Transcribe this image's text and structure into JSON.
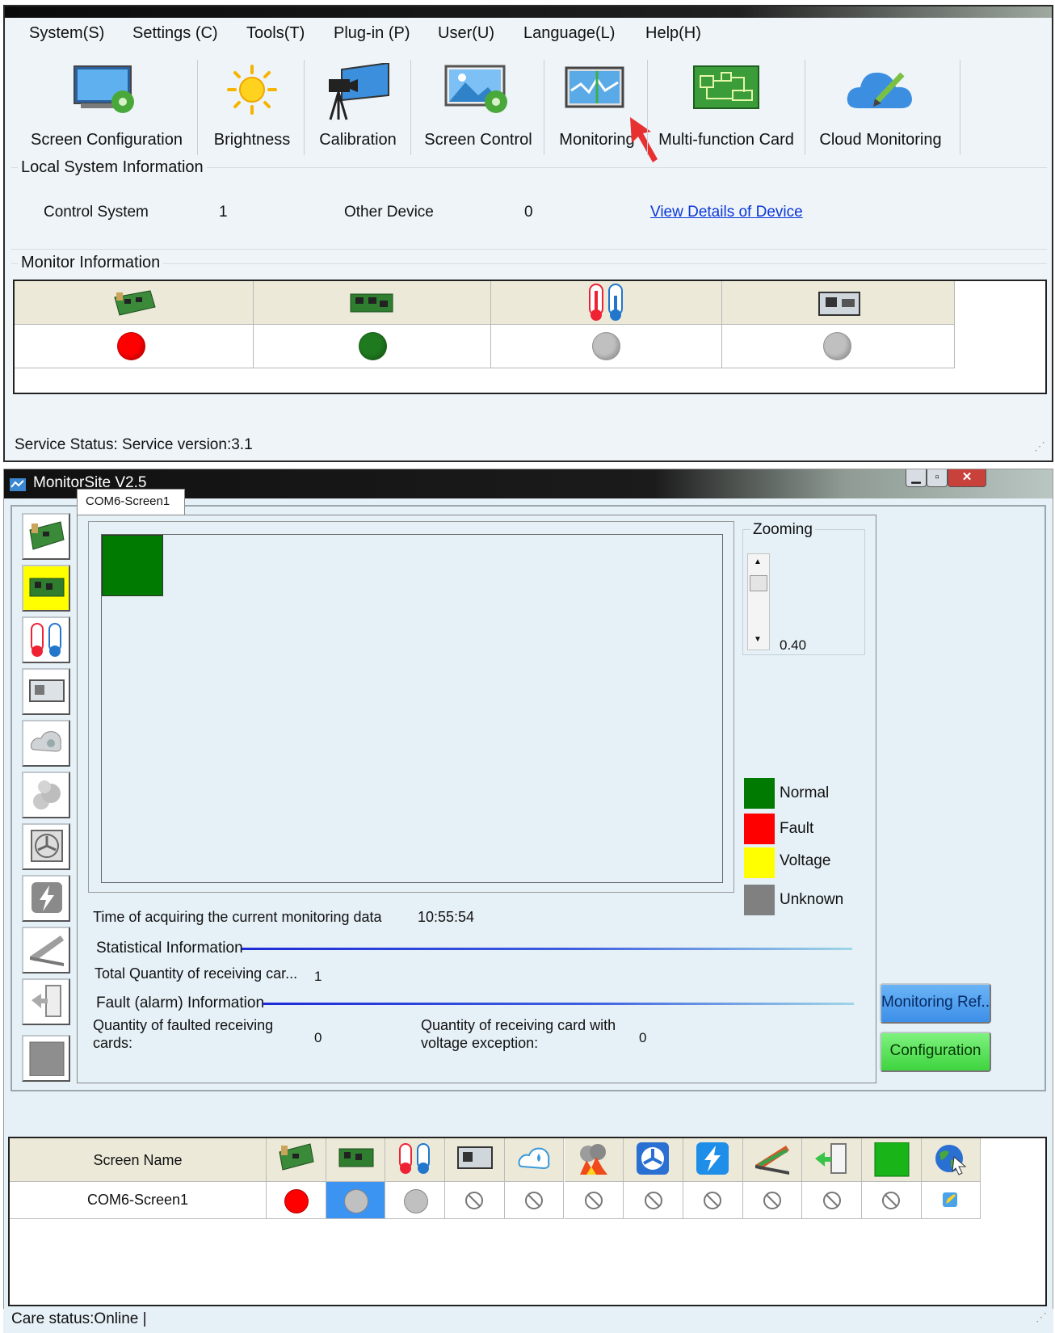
{
  "top_window": {
    "menu": [
      "System(S)",
      "Settings (C)",
      "Tools(T)",
      "Plug-in (P)",
      "User(U)",
      "Language(L)",
      "Help(H)"
    ],
    "toolbar": [
      {
        "label": "Screen Configuration",
        "icon": "screen-config-icon"
      },
      {
        "label": "Brightness",
        "icon": "sun-icon"
      },
      {
        "label": "Calibration",
        "icon": "camera-projector-icon"
      },
      {
        "label": "Screen Control",
        "icon": "screen-control-icon"
      },
      {
        "label": "Monitoring",
        "icon": "monitor-waveform-icon"
      },
      {
        "label": "Multi-function Card",
        "icon": "circuit-board-icon"
      },
      {
        "label": "Cloud Monitoring",
        "icon": "cloud-pencil-icon"
      }
    ],
    "local_system": {
      "title": "Local System Information",
      "control_system_label": "Control System",
      "control_system_value": "1",
      "other_device_label": "Other Device",
      "other_device_value": "0",
      "view_details_link": "View Details of Device"
    },
    "monitor_info": {
      "title": "Monitor Information",
      "columns": [
        {
          "icon": "sending-card-icon",
          "status_color": "#ff0000"
        },
        {
          "icon": "receiving-card-icon",
          "status_color": "#1f7a1f"
        },
        {
          "icon": "thermometer-icon",
          "status_color": "#c0c0c0"
        },
        {
          "icon": "module-board-icon",
          "status_color": "#c0c0c0"
        }
      ]
    },
    "status": "Service Status:  Service version:3.1"
  },
  "monitor_window": {
    "title": "MonitorSite V2.5",
    "tab": "COM6-Screen1",
    "zoom": {
      "label": "Zooming",
      "value": "0.40"
    },
    "legend": [
      {
        "label": "Normal",
        "color": "#007a00"
      },
      {
        "label": "Fault",
        "color": "#ff0000"
      },
      {
        "label": "Voltage",
        "color": "#ffff00"
      },
      {
        "label": "Unknown",
        "color": "#808080"
      }
    ],
    "acquire_time_label": "Time of acquiring the current monitoring data",
    "acquire_time_value": "10:55:54",
    "statistical_title": "Statistical Information",
    "total_qty_label": "Total Quantity of receiving car...",
    "total_qty_value": "1",
    "fault_title": "Fault (alarm) Information",
    "faulted_label_1": "Quantity of faulted receiving",
    "faulted_label_2": "cards:",
    "faulted_value": "0",
    "voltage_label_1": "Quantity of receiving card with",
    "voltage_label_2": "voltage exception:",
    "voltage_value": "0",
    "buttons": {
      "refresh": "Monitoring Ref...",
      "configuration": "Configuration"
    },
    "sidebar_icons": [
      "sending-card-icon",
      "receiving-card-icon",
      "thermometer-icon",
      "module-board-icon",
      "humidity-icon",
      "smoke-icon",
      "fan-icon",
      "power-icon",
      "flat-cable-icon",
      "door-icon",
      "led-module-icon"
    ],
    "grid": {
      "header_label": "Screen Name",
      "header_icons": [
        "sending-card-icon",
        "receiving-card-icon",
        "thermometer-icon",
        "module-board-icon",
        "humidity-icon",
        "smoke-fire-icon",
        "fan-icon",
        "power-icon",
        "flat-cable-icon",
        "door-icon",
        "led-module-icon",
        "globe-icon"
      ],
      "rows": [
        {
          "name": "COM6-Screen1",
          "cells": [
            "red",
            "gray-selected",
            "gray",
            "none",
            "none",
            "none",
            "none",
            "none",
            "none",
            "none",
            "none",
            "edit"
          ]
        }
      ]
    },
    "status": "Care status:Online  |"
  }
}
